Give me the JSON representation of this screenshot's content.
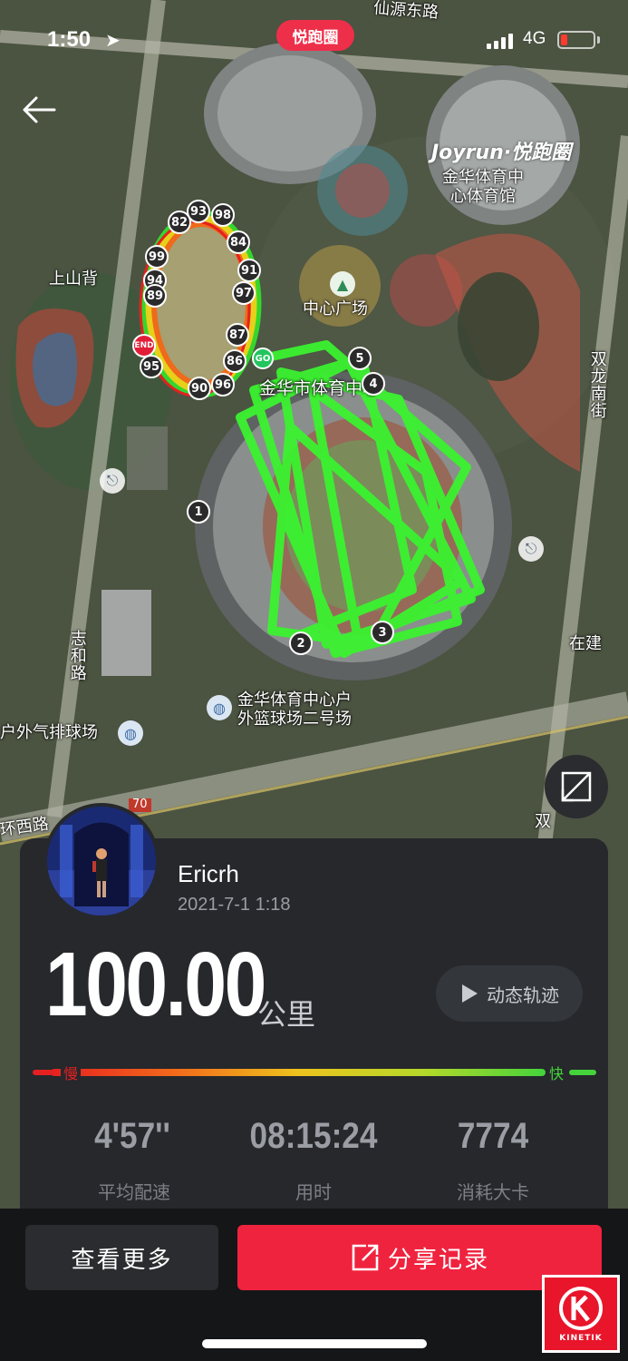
{
  "status_bar": {
    "time": "1:50",
    "network": "4G",
    "app_pill": "悦跑圈"
  },
  "watermark": "Joyrun·悦跑圈",
  "map": {
    "labels": {
      "road_top": "仙源东路",
      "stadium_right": "金华体育中\n心体育馆",
      "shangshanbei": "上山背",
      "plaza": "中心广场",
      "center_name": "金华市体育中心",
      "shuanglong": "双龙南街",
      "zhihe": "志和路",
      "court": "金华体育中心户\n外篮球场二号场",
      "volleyball": "户外气排球场",
      "zaijian": "在建",
      "huanxi": "环西路",
      "shuang_bottom": "双",
      "sign_100": "70"
    },
    "km_markers": [
      "1",
      "2",
      "3",
      "4",
      "5"
    ],
    "loop_markers": [
      "82",
      "93",
      "98",
      "84",
      "91",
      "99",
      "94",
      "89",
      "97",
      "87",
      "86",
      "95",
      "90",
      "96"
    ],
    "go": "GO",
    "end": "END"
  },
  "profile": {
    "name": "Ericrh",
    "date": "2021-7-1 1:18"
  },
  "distance": {
    "value": "100.00",
    "unit": "公里"
  },
  "replay_label": "动态轨迹",
  "pace_scale": {
    "slow": "慢",
    "fast": "快"
  },
  "stats": [
    {
      "value": "4'57''",
      "label": "平均配速"
    },
    {
      "value": "08:15:24",
      "label": "用时"
    },
    {
      "value": "7774",
      "label": "消耗大卡"
    }
  ],
  "buttons": {
    "more": "查看更多",
    "share": "分享记录"
  },
  "brand": "KINETIK",
  "colors": {
    "accent": "#f0233f",
    "track": "#2ee82e",
    "card_bg": "#26282c"
  }
}
